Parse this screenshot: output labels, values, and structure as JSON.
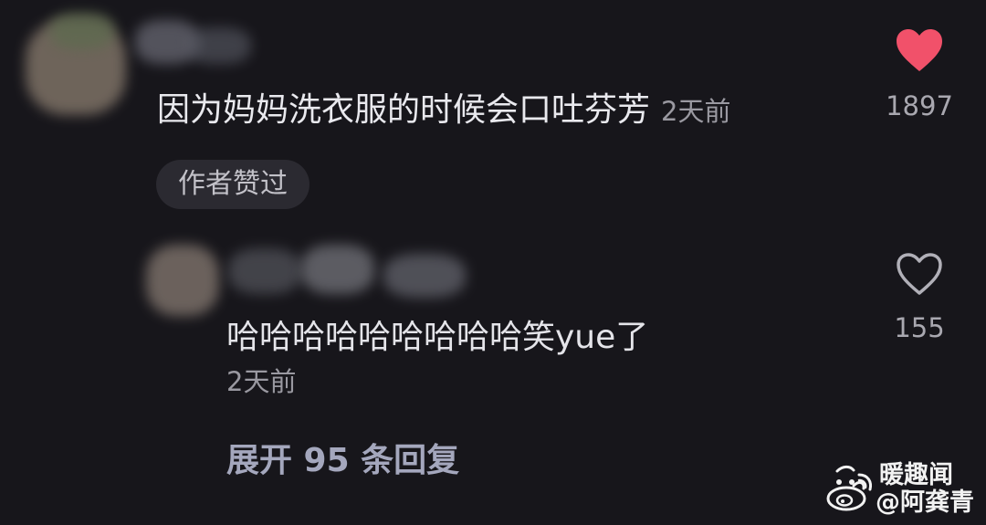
{
  "comment": {
    "text": "因为妈妈洗衣服的时候会口吐芬芳",
    "time": "2天前",
    "badge": "作者赞过",
    "likes": "1897",
    "like_icon": "heart-filled-icon",
    "liked": true
  },
  "reply": {
    "text": "哈哈哈哈哈哈哈哈哈笑yue了",
    "time": "2天前",
    "likes": "155",
    "like_icon": "heart-outline-icon",
    "liked": false
  },
  "expand_replies": "展开 95 条回复",
  "watermark": {
    "line1": "暖趣闻",
    "line2": "@阿龚青",
    "icon": "weibo-icon"
  },
  "colors": {
    "background": "#17161b",
    "heart": "#f1516a",
    "primary_text": "#e9e9ee",
    "secondary_text": "#9a99a1",
    "link_text": "#a4a7bd",
    "badge_bg": "#2b2a31"
  }
}
